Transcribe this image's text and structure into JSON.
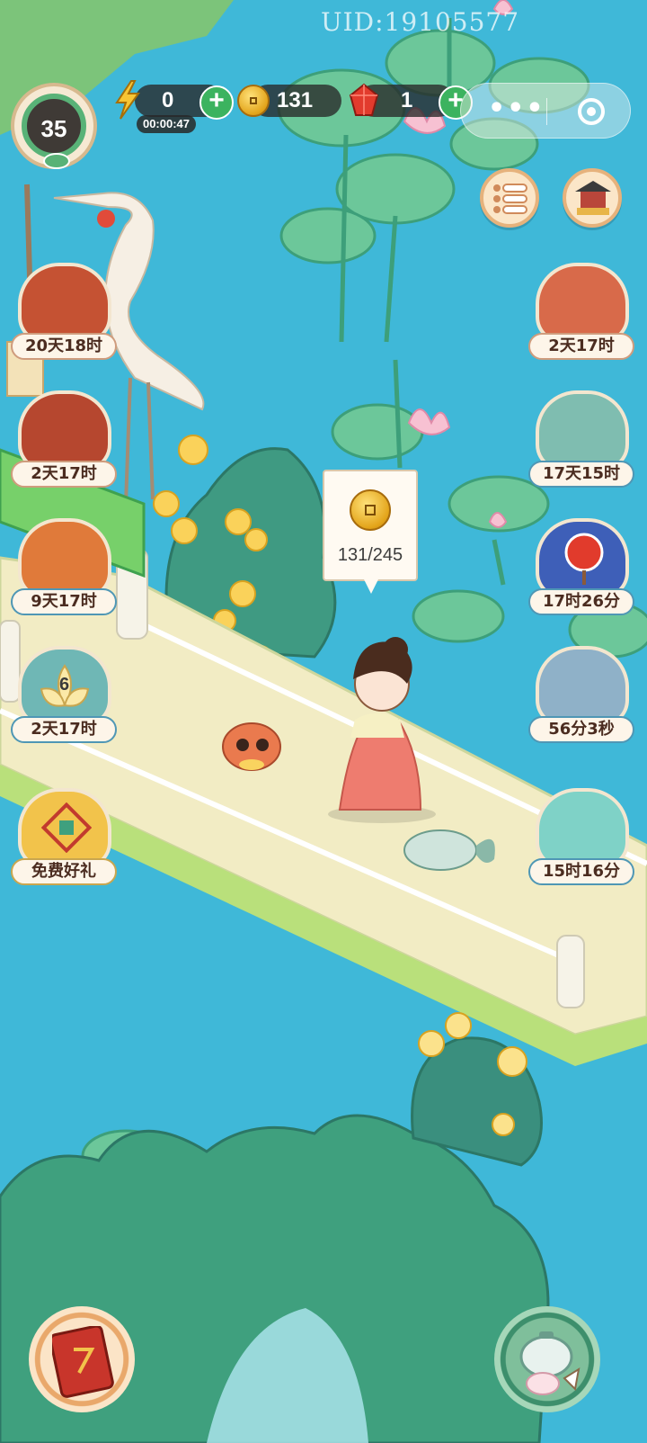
{
  "uid": "UID:19105577",
  "hud": {
    "level": "35",
    "energy": {
      "value": "0",
      "timer": "00:00:47",
      "icon": "lightning-icon"
    },
    "coins": {
      "value": "131",
      "icon": "coin-icon"
    },
    "gems": {
      "value": "1",
      "icon": "red-gem-icon"
    },
    "plus_symbol": "+",
    "mini_program": {
      "menu": "•••",
      "menu_icon": "more-dots-icon",
      "close_icon": "target-icon"
    }
  },
  "top_right_buttons": [
    {
      "icon": "list-menu-icon"
    },
    {
      "icon": "pavilion-shop-icon"
    }
  ],
  "left_events": [
    {
      "label": "20天18时",
      "icon": "book-event-icon"
    },
    {
      "label": "2天17时",
      "icon": "tea-set-event-icon"
    },
    {
      "label": "9天17时",
      "icon": "phoenix-event-icon"
    },
    {
      "label": "2天17时",
      "icon": "lotus-event-icon",
      "badge": "6"
    },
    {
      "label": "免费好礼",
      "icon": "free-gift-icon"
    }
  ],
  "right_events": [
    {
      "label": "2天17时",
      "icon": "cat-fan-event-icon"
    },
    {
      "label": "17天15时",
      "icon": "cat-bath-event-icon"
    },
    {
      "label": "17时26分",
      "icon": "fan-event-icon"
    },
    {
      "label": "56分3秒",
      "icon": "treasure-box-event-icon"
    },
    {
      "label": "15时16分",
      "icon": "cat-gift-event-icon"
    }
  ],
  "coin_tooltip": {
    "text": "131/245",
    "icon": "coin-icon"
  },
  "bottom_buttons": [
    {
      "icon": "red-book-icon"
    },
    {
      "icon": "teapot-rabbit-icon"
    }
  ],
  "colors": {
    "water": "#3fb8d8",
    "bridge": "#f2ecc4",
    "rock": "#3f9a82",
    "leaf": "#5cc08a"
  }
}
